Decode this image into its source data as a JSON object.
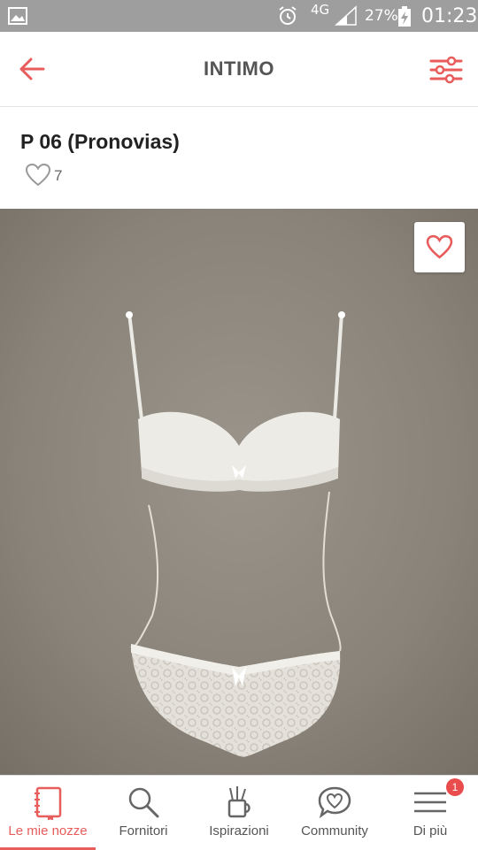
{
  "status_bar": {
    "network": "4G",
    "battery": "27%",
    "time": "01:23"
  },
  "header": {
    "title": "INTIMO"
  },
  "product": {
    "title": "P 06 (Pronovias)",
    "likes": "7"
  },
  "colors": {
    "accent": "#e85c5c",
    "status_bar": "#9e9e9e",
    "photo_background": "#8c857b"
  },
  "nav": {
    "items": [
      {
        "label": "Le mie nozze",
        "icon": "notebook-icon",
        "active": true
      },
      {
        "label": "Fornitori",
        "icon": "search-icon",
        "active": false
      },
      {
        "label": "Ispirazioni",
        "icon": "pencil-cup-icon",
        "active": false
      },
      {
        "label": "Community",
        "icon": "chat-heart-icon",
        "active": false
      },
      {
        "label": "Di più",
        "icon": "menu-icon",
        "active": false
      }
    ],
    "badge": "1"
  }
}
